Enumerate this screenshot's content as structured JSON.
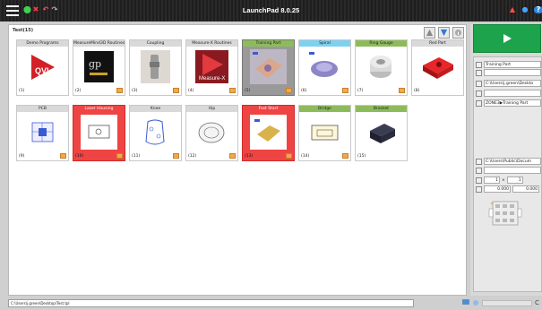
{
  "app": {
    "title": "LaunchPad 8.0.25"
  },
  "main": {
    "heading": "Test(15)",
    "tiles": [
      {
        "label": "Demo Programs",
        "num": "(1)",
        "header": "gray"
      },
      {
        "label": "MeasureMind3D Routines",
        "num": "(2)",
        "header": "gray"
      },
      {
        "label": "Coupling",
        "num": "(3)",
        "header": "gray"
      },
      {
        "label": "Measure-X Routines",
        "num": "(4)",
        "header": "gray"
      },
      {
        "label": "Training Part",
        "num": "(5)",
        "header": "green"
      },
      {
        "label": "Spiral",
        "num": "(6)",
        "header": "cyan"
      },
      {
        "label": "Ring Gauge",
        "num": "(7)",
        "header": "green"
      },
      {
        "label": "Red Part",
        "num": "(8)",
        "header": "gray"
      },
      {
        "label": "PCB",
        "num": "(9)",
        "header": "gray"
      },
      {
        "label": "Laser Housing",
        "num": "(10)",
        "header": "selected"
      },
      {
        "label": "Knee",
        "num": "(11)",
        "header": "gray"
      },
      {
        "label": "Hip",
        "num": "(12)",
        "header": "gray"
      },
      {
        "label": "Fast Start",
        "num": "(13)",
        "header": "selected"
      },
      {
        "label": "Bridge",
        "num": "(14)",
        "header": "green"
      },
      {
        "label": "Bracket",
        "num": "(15)",
        "header": "green"
      }
    ]
  },
  "props": {
    "name": "Training Part",
    "path1": "C:\\Users\\j.green\\Deskto",
    "zone": "ZONE3▶Training Part",
    "path2": "C:\\Users\\Public\\Docum",
    "count_a": "1",
    "count_b": "1",
    "offset_a": "0.000",
    "offset_b": "0.000"
  },
  "status": {
    "path": "C:\\Users\\j.green\\Desktop\\Test.tpl"
  },
  "colors": {
    "run": "#1ca34b",
    "selected": "#ef4444",
    "green_header": "#8dbb5b",
    "cyan_header": "#7fd0ef"
  }
}
